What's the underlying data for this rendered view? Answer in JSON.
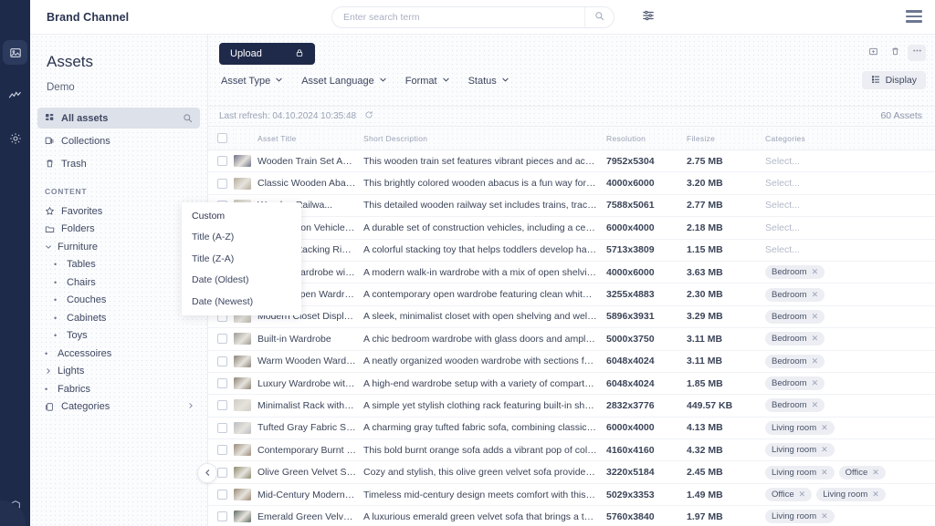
{
  "rail": {
    "items": [
      {
        "name": "assets-icon",
        "active": true
      },
      {
        "name": "analytics-icon",
        "active": false
      },
      {
        "name": "settings-icon",
        "active": false
      }
    ],
    "bottom_item": {
      "name": "help-icon"
    }
  },
  "topbar": {
    "brand": "Brand Channel",
    "search_placeholder": "Enter search term",
    "search_value": "",
    "search_icon": "search-icon",
    "filter_icon": "sliders-icon",
    "menu_icon": "hamburger-icon"
  },
  "nav": {
    "title": "Assets",
    "subtitle": "Demo",
    "primary": [
      {
        "label": "All assets",
        "icon": "grid-icon",
        "trailing": "search-icon",
        "active": true
      },
      {
        "label": "Collections",
        "icon": "collections-icon",
        "active": false
      },
      {
        "label": "Trash",
        "icon": "trash-icon",
        "active": false
      }
    ],
    "section_label": "CONTENT",
    "section_icon": "sort-filter-icon",
    "tree": [
      {
        "label": "Favorites",
        "icon": "star-icon",
        "kind": "icon"
      },
      {
        "label": "Folders",
        "icon": "folder-icon",
        "kind": "icon"
      },
      {
        "label": "Furniture",
        "icon": "chevron-down-icon",
        "kind": "expanded"
      },
      {
        "label": "Tables",
        "icon": "dot-icon",
        "kind": "child"
      },
      {
        "label": "Chairs",
        "icon": "dot-icon",
        "kind": "child"
      },
      {
        "label": "Couches",
        "icon": "dot-icon",
        "kind": "child"
      },
      {
        "label": "Cabinets",
        "icon": "dot-icon",
        "kind": "child"
      },
      {
        "label": "Toys",
        "icon": "dot-icon",
        "kind": "child"
      },
      {
        "label": "Accessoires",
        "icon": "dot-icon",
        "kind": "leaf"
      },
      {
        "label": "Lights",
        "icon": "chevron-right-icon",
        "kind": "collapsed"
      },
      {
        "label": "Fabrics",
        "icon": "dot-icon",
        "kind": "leaf"
      },
      {
        "label": "Categories",
        "icon": "categories-icon",
        "kind": "icon",
        "trailing": "chevron-right-icon"
      }
    ],
    "collapse_icon": "chevron-left-icon"
  },
  "toolbar": {
    "upload_label": "Upload",
    "upload_icon": "lock-icon",
    "facets": [
      {
        "label": "Asset Type",
        "icon": "chevron-down-icon"
      },
      {
        "label": "Asset Language",
        "icon": "chevron-down-icon"
      },
      {
        "label": "Format",
        "icon": "chevron-down-icon"
      },
      {
        "label": "Status",
        "icon": "chevron-down-icon"
      }
    ],
    "icons": [
      {
        "name": "add-to-collection-icon",
        "filled": false
      },
      {
        "name": "trash-icon",
        "filled": false
      },
      {
        "name": "more-options-icon",
        "filled": true
      }
    ],
    "display_label": "Display",
    "display_icon": "layout-icon"
  },
  "status": {
    "last_refresh": "Last refresh: 04.10.2024 10:35:48",
    "refresh_icon": "refresh-icon",
    "asset_count": "60 Assets"
  },
  "sort_menu": {
    "items": [
      "Custom",
      "Title (A-Z)",
      "Title (Z-A)",
      "Date (Oldest)",
      "Date (Newest)"
    ]
  },
  "table": {
    "columns": [
      "",
      "",
      "Asset Title",
      "Short Description",
      "Resolution",
      "Filesize",
      "Categories"
    ],
    "select_placeholder": "Select...",
    "rows": [
      {
        "title": "Wooden Train Set Adve...",
        "description": "This wooden train set features vibrant pieces and accessories for ...",
        "resolution": "7952x5304",
        "filesize": "2.75 MB",
        "categories": [],
        "thumb": "#6d7186"
      },
      {
        "title": "Classic Wooden Abacus",
        "description": "This brightly colored wooden abacus is a fun way for children to le...",
        "resolution": "4000x6000",
        "filesize": "3.20 MB",
        "categories": [],
        "thumb": "#b6ad9c"
      },
      {
        "title": "Wooden Railwa...",
        "description": "This detailed wooden railway set includes trains, tracks, and a sta...",
        "resolution": "7588x5061",
        "filesize": "2.77 MB",
        "categories": [],
        "thumb": "#c9c3b6"
      },
      {
        "title": "Construction Vehicle Pl...",
        "description": "A durable set of construction vehicles, including a cement mixer a...",
        "resolution": "6000x4000",
        "filesize": "2.18 MB",
        "categories": [],
        "thumb": "#c2b9a7"
      },
      {
        "title": "Colorful Stacking Ring ...",
        "description": "A colorful stacking toy that helps toddlers develop hand-eye coor...",
        "resolution": "5713x3809",
        "filesize": "1.15 MB",
        "categories": [],
        "thumb": "#cdc7bd"
      },
      {
        "title": "Walk-in Wardrobe with ...",
        "description": "A modern walk-in wardrobe with a mix of open shelving and cabin...",
        "resolution": "4000x6000",
        "filesize": "3.63 MB",
        "categories": [
          "Bedroom"
        ],
        "thumb": "#a9a296"
      },
      {
        "title": "Modern Open Wardrobe ...",
        "description": "A contemporary open wardrobe featuring clean white cabinetry. T...",
        "resolution": "3255x4883",
        "filesize": "2.30 MB",
        "categories": [
          "Bedroom"
        ],
        "thumb": "#d5d2cc"
      },
      {
        "title": "Modern Closet Display ...",
        "description": "A sleek, minimalist closet with open shelving and well-arranged g...",
        "resolution": "5896x3931",
        "filesize": "3.29 MB",
        "categories": [
          "Bedroom"
        ],
        "thumb": "#b8b3a9"
      },
      {
        "title": "Built-in Wardrobe",
        "description": "A chic bedroom wardrobe with glass doors and ample shelving. T...",
        "resolution": "5000x3750",
        "filesize": "3.11 MB",
        "categories": [
          "Bedroom"
        ],
        "thumb": "#9d9a95"
      },
      {
        "title": "Warm Wooden Wardro...",
        "description": "A neatly organized wooden wardrobe with sections for clothes an...",
        "resolution": "6048x4024",
        "filesize": "3.11 MB",
        "categories": [
          "Bedroom"
        ],
        "thumb": "#8a8377"
      },
      {
        "title": "Luxury Wardrobe with ...",
        "description": "A high-end wardrobe setup with a variety of compartments. The ri...",
        "resolution": "6048x4024",
        "filesize": "1.85 MB",
        "categories": [
          "Bedroom"
        ],
        "thumb": "#8d8374"
      },
      {
        "title": "Minimalist Rack with C...",
        "description": "A simple yet stylish clothing rack featuring built-in shelves for sho...",
        "resolution": "2832x3776",
        "filesize": "449.57 KB",
        "categories": [
          "Bedroom"
        ],
        "thumb": "#cfccc6"
      },
      {
        "title": "Tufted Gray Fabric Sofa",
        "description": "A charming gray tufted fabric sofa, combining classic design with ...",
        "resolution": "6000x4000",
        "filesize": "4.13 MB",
        "categories": [
          "Living room"
        ],
        "thumb": "#b9bcc1"
      },
      {
        "title": "Contemporary Burnt O...",
        "description": "This bold burnt orange sofa adds a vibrant pop of color and style t...",
        "resolution": "4160x4160",
        "filesize": "4.32 MB",
        "categories": [
          "Living room"
        ],
        "thumb": "#9a8a7a"
      },
      {
        "title": "Olive Green Velvet Sofa",
        "description": "Cozy and stylish, this olive green velvet sofa provides both warmt...",
        "resolution": "3220x5184",
        "filesize": "2.45 MB",
        "categories": [
          "Living room",
          "Office"
        ],
        "thumb": "#8d8a6f"
      },
      {
        "title": "Mid-Century Modern Le...",
        "description": "Timeless mid-century design meets comfort with this brown leath...",
        "resolution": "5029x3353",
        "filesize": "1.49 MB",
        "categories": [
          "Office",
          "Living room"
        ],
        "thumb": "#9b8a74"
      },
      {
        "title": "Emerald Green Velvet S...",
        "description": "A luxurious emerald green velvet sofa that brings a touch of elega...",
        "resolution": "5760x3840",
        "filesize": "1.97 MB",
        "categories": [
          "Living room"
        ],
        "thumb": "#5e6a63"
      }
    ]
  },
  "colors": {
    "rail_bg": "#1e2a4a",
    "upload_bg": "#1f2a4a",
    "tag_bg": "#eceef3",
    "page_bg": "#fbfcfd"
  }
}
